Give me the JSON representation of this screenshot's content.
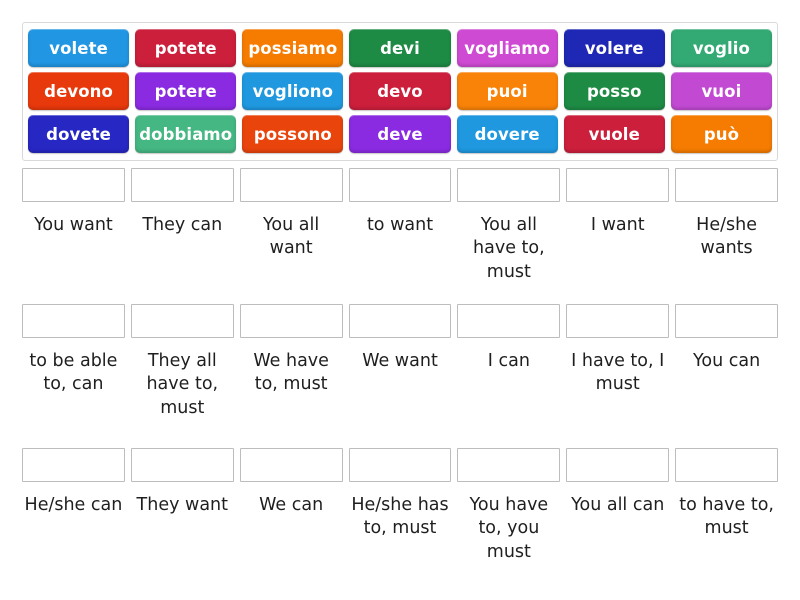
{
  "activity": {
    "type": "match-up",
    "language_pair": "Italian to English",
    "tile_text_color": "#ffffff",
    "drop_box_border_color": "#bdbdbd",
    "tray_border_color": "#d9d9d9",
    "background_color": "#ffffff"
  },
  "tiles": {
    "rows": [
      [
        {
          "label": "volete",
          "color": "#2196e3"
        },
        {
          "label": "potete",
          "color": "#cc1f3c"
        },
        {
          "label": "possiamo",
          "color": "#f57c00"
        },
        {
          "label": "devi",
          "color": "#1e8b45"
        },
        {
          "label": "vogliamo",
          "color": "#cf4ad3"
        },
        {
          "label": "volere",
          "color": "#1f28b5"
        },
        {
          "label": "voglio",
          "color": "#33aa74"
        }
      ],
      [
        {
          "label": "devono",
          "color": "#e8390c"
        },
        {
          "label": "potere",
          "color": "#8a2be2"
        },
        {
          "label": "vogliono",
          "color": "#1f98e0"
        },
        {
          "label": "devo",
          "color": "#cc1f3c"
        },
        {
          "label": "puoi",
          "color": "#f98308"
        },
        {
          "label": "posso",
          "color": "#1e8b45"
        },
        {
          "label": "vuoi",
          "color": "#c24ad3"
        }
      ],
      [
        {
          "label": "dovete",
          "color": "#2727c4"
        },
        {
          "label": "dobbiamo",
          "color": "#45b783"
        },
        {
          "label": "possono",
          "color": "#e8440c"
        },
        {
          "label": "deve",
          "color": "#8a2be2"
        },
        {
          "label": "dovere",
          "color": "#1f98e0"
        },
        {
          "label": "vuole",
          "color": "#cc1f3c"
        },
        {
          "label": "può",
          "color": "#f57c00"
        }
      ]
    ]
  },
  "answers": {
    "rows": [
      [
        {
          "drop_value": "",
          "label": "You want"
        },
        {
          "drop_value": "",
          "label": "They can"
        },
        {
          "drop_value": "",
          "label": "You all want"
        },
        {
          "drop_value": "",
          "label": "to want"
        },
        {
          "drop_value": "",
          "label": "You all have to, must"
        },
        {
          "drop_value": "",
          "label": "I want"
        },
        {
          "drop_value": "",
          "label": "He/she wants"
        }
      ],
      [
        {
          "drop_value": "",
          "label": "to be able to, can"
        },
        {
          "drop_value": "",
          "label": "They all have to, must"
        },
        {
          "drop_value": "",
          "label": "We have to, must"
        },
        {
          "drop_value": "",
          "label": "We want"
        },
        {
          "drop_value": "",
          "label": "I can"
        },
        {
          "drop_value": "",
          "label": "I have to, I must"
        },
        {
          "drop_value": "",
          "label": "You can"
        }
      ],
      [
        {
          "drop_value": "",
          "label": "He/she can"
        },
        {
          "drop_value": "",
          "label": "They want"
        },
        {
          "drop_value": "",
          "label": "We can"
        },
        {
          "drop_value": "",
          "label": "He/she has to, must"
        },
        {
          "drop_value": "",
          "label": "You have to, you must"
        },
        {
          "drop_value": "",
          "label": "You all can"
        },
        {
          "drop_value": "",
          "label": "to have to, must"
        }
      ]
    ]
  }
}
